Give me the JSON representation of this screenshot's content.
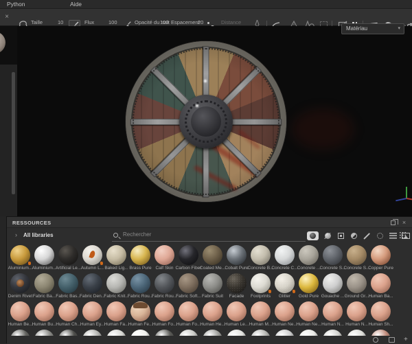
{
  "menu": {
    "items": [
      "Python",
      "Aide"
    ]
  },
  "toolbar": {
    "close_label": "×",
    "size": {
      "label": "Taille",
      "value": "10"
    },
    "flow": {
      "label": "Flux",
      "value": "100"
    },
    "stroke_opacity": {
      "label": "Opacité du trait",
      "value": "100"
    },
    "spacing": {
      "label": "Espacement",
      "value": "20"
    },
    "distance": {
      "label": "Distance"
    },
    "icons": [
      "brush-stamp",
      "brush",
      "pen-pressure",
      "spacing-dots",
      "falloff-curve",
      "symmetry",
      "symmetry-plane",
      "uv-frame",
      "projection-off",
      "pause",
      "perspective-view",
      "material-view",
      "camera-view",
      "screenshot"
    ]
  },
  "viewport": {
    "material_dropdown": "Matériau",
    "gizmo_axes": [
      "x-red",
      "y-green",
      "z-blue"
    ],
    "model": "viking round shield"
  },
  "resources": {
    "title": "RESSOURCES",
    "library_label": "All libraries",
    "search_placeholder": "Rechercher",
    "filter_icons": [
      "materials-selected",
      "smart-materials",
      "smart-masks",
      "filters",
      "brushes",
      "particles",
      "procedurals",
      "textures"
    ],
    "grid_view_icon": "grid-view",
    "footer_icons": [
      "circle",
      "image-frame",
      "plus"
    ],
    "rows": [
      [
        {
          "l": "Aluminium...",
          "c": "#c89a3c",
          "d": "#5e4412",
          "h": "#f0d28a",
          "v": "speckle",
          "b": true
        },
        {
          "l": "Aluminium...",
          "c": "#d6d6d6",
          "h": "#ffffff",
          "d": "#4e4e4e"
        },
        {
          "l": "Artificial Le...",
          "c": "#2e2c2a",
          "d": "#121110",
          "h": "#5a5650"
        },
        {
          "l": "Autumn L...",
          "c": "#dcd8d0",
          "d": "#86847c",
          "h": "#f4f2ec",
          "v": "leaf",
          "b": true
        },
        {
          "l": "Baked Lig...",
          "c": "#c6bca4",
          "d": "#6e6650",
          "h": "#e8e0cc"
        },
        {
          "l": "Brass Pure",
          "c": "#d6b44e",
          "d": "#6a4e14",
          "h": "#f6ecc0"
        },
        {
          "l": "Calf Skin",
          "c": "#dfa896",
          "d": "#8a5a4c",
          "h": "#f2cfc2"
        },
        {
          "l": "Carbon Fiber",
          "c": "#26262a",
          "d": "#0c0c0e",
          "h": "#72727c"
        },
        {
          "l": "Coated Me...",
          "c": "#6e604a",
          "d": "#332c1e",
          "h": "#9a8c70"
        },
        {
          "l": "Cobalt Pure",
          "c": "#6a7076",
          "d": "#1e2226",
          "h": "#c6ccd2"
        },
        {
          "l": "Concrete B...",
          "c": "#c2bcac",
          "d": "#6e6a5e",
          "h": "#e4e0d2",
          "v": "speckle"
        },
        {
          "l": "Concrete C...",
          "c": "#d6d8d8",
          "d": "#82868a",
          "h": "#f2f4f4"
        },
        {
          "l": "Concrete ...",
          "c": "#a8a49a",
          "d": "#5e5a52",
          "h": "#ccc8be",
          "v": "speckle"
        },
        {
          "l": "Concrete S...",
          "c": "#60646a",
          "d": "#2a2c30",
          "h": "#8e9298"
        },
        {
          "l": "Concrete S...",
          "c": "#a48a66",
          "d": "#584834",
          "h": "#c8b08c",
          "v": "speckle"
        },
        {
          "l": "Copper Pure",
          "c": "#d49a7c",
          "d": "#6e3c26",
          "h": "#f4d8c4"
        }
      ],
      [
        {
          "l": "Denim Rivet",
          "c": "#34363c",
          "d": "#16181c",
          "h": "#5e626a",
          "v": "rivet"
        },
        {
          "l": "Fabric Ba...",
          "c": "#8c8672",
          "d": "#4a4638",
          "h": "#b2ac98"
        },
        {
          "l": "Fabric Bas...",
          "c": "#44606a",
          "d": "#1e3038",
          "h": "#6e8a94"
        },
        {
          "l": "Fabric Den...",
          "c": "#3a4048",
          "d": "#181c22",
          "h": "#646c76"
        },
        {
          "l": "Fabric Knit...",
          "c": "#b6b6b2",
          "d": "#64645e",
          "h": "#dcdcd8"
        },
        {
          "l": "Fabric Rou...",
          "c": "#4c6678",
          "d": "#22323e",
          "h": "#7a94a6"
        },
        {
          "l": "Fabric Rou...",
          "c": "#53565a",
          "d": "#26282c",
          "h": "#84888c"
        },
        {
          "l": "Fabric Soft...",
          "c": "#7e6e5e",
          "d": "#40362c",
          "h": "#a89886"
        },
        {
          "l": "Fabric Suit",
          "c": "#8e8e8a",
          "d": "#4a4a46",
          "h": "#b8b8b4"
        },
        {
          "l": "Facade",
          "c": "#38342e",
          "d": "#121110",
          "h": "#6a645a",
          "v": "glitter"
        },
        {
          "l": "Footprints",
          "c": "#dcdad2",
          "d": "#8a887e",
          "h": "#f6f4ee",
          "b": true
        },
        {
          "l": "Glitter",
          "c": "#d6d2c8",
          "d": "#88847a",
          "h": "#f4f0e8",
          "v": "glitter",
          "b": true
        },
        {
          "l": "Gold Pure",
          "c": "#dcb83e",
          "d": "#76550e",
          "h": "#fef2c0"
        },
        {
          "l": "Gouache ...",
          "c": "#cecece",
          "d": "#767672",
          "h": "#efefed"
        },
        {
          "l": "Ground Gr...",
          "c": "#9a9288",
          "d": "#524c44",
          "h": "#c0b8ac",
          "v": "speckle"
        },
        {
          "l": "Human Ba...",
          "c": "#dba28c",
          "d": "#8a5a48",
          "h": "#f0c8b6"
        }
      ],
      [
        {
          "l": "Human Be...",
          "c": "#dba28c",
          "d": "#8a5a48",
          "h": "#f0c8b6"
        },
        {
          "l": "Human Bu...",
          "c": "#dba28c",
          "d": "#8a5a48",
          "h": "#f0c8b6"
        },
        {
          "l": "Human Ch...",
          "c": "#dba28c",
          "d": "#8a5a48",
          "h": "#f0c8b6"
        },
        {
          "l": "Human Ey...",
          "c": "#dba28c",
          "d": "#8a5a48",
          "h": "#f0c8b6"
        },
        {
          "l": "Human Fa...",
          "c": "#dba28c",
          "d": "#8a5a48",
          "h": "#f0c8b6"
        },
        {
          "l": "Human Fe...",
          "c": "#d8b498",
          "d": "#8a5a48",
          "h": "#f0d8c0",
          "v": "face"
        },
        {
          "l": "Human Fo...",
          "c": "#dba28c",
          "d": "#8a5a48",
          "h": "#f0c8b6"
        },
        {
          "l": "Human Fo...",
          "c": "#dba28c",
          "d": "#8a5a48",
          "h": "#f0c8b6"
        },
        {
          "l": "Human He...",
          "c": "#dba28c",
          "d": "#8a5a48",
          "h": "#f0c8b6"
        },
        {
          "l": "Human Le...",
          "c": "#dba28c",
          "d": "#8a5a48",
          "h": "#f0c8b6"
        },
        {
          "l": "Human M...",
          "c": "#dba28c",
          "d": "#8a5a48",
          "h": "#f0c8b6"
        },
        {
          "l": "Human Ne...",
          "c": "#dba28c",
          "d": "#8a5a48",
          "h": "#f0c8b6"
        },
        {
          "l": "Human Ne...",
          "c": "#dba28c",
          "d": "#8a5a48",
          "h": "#f0c8b6"
        },
        {
          "l": "Human N...",
          "c": "#dba28c",
          "d": "#8a5a48",
          "h": "#f0c8b6"
        },
        {
          "l": "Human N...",
          "c": "#dba28c",
          "d": "#8a5a48",
          "h": "#f0c8b6"
        },
        {
          "l": "Human Sh...",
          "c": "#dba28c",
          "d": "#8a5a48",
          "h": "#f0c8b6"
        }
      ]
    ],
    "partial_row_colors": [
      "#62625e",
      "#8a8a86",
      "#4e4e4a",
      "#b2b2ae",
      "#d6d6d2",
      "#efefeb",
      "#5a5a56",
      "#c8c8c4",
      "#9e9e9a",
      "#e2e2de",
      "#b4b4b0",
      "#cccccc",
      "#e8e8e4",
      "#d2d2ce",
      "#dcdcd8",
      "#c08a7a"
    ]
  }
}
